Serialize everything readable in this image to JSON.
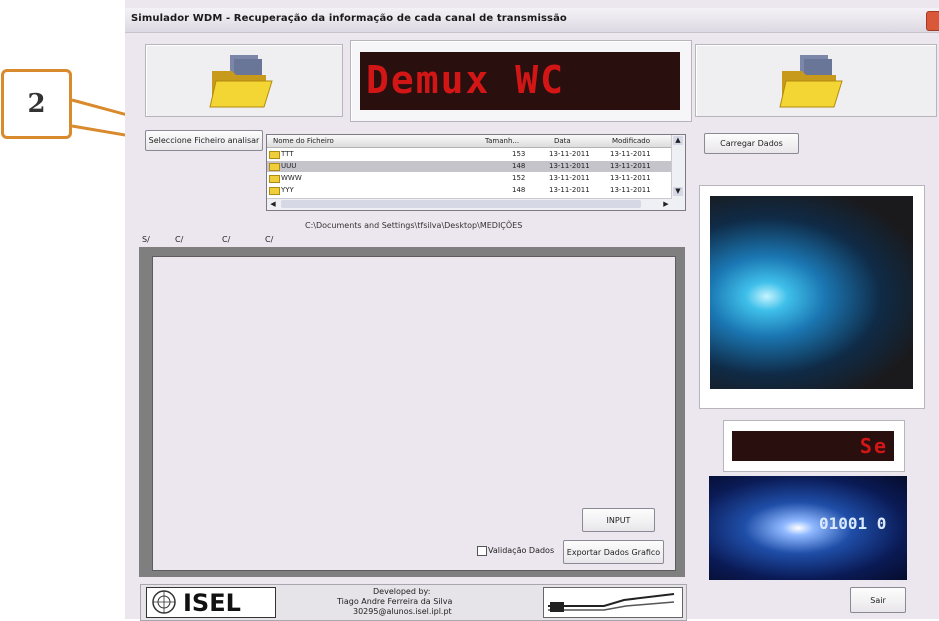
{
  "window": {
    "title": "Simulador WDM - Recuperação da informação de cada canal de transmissão"
  },
  "top_led": {
    "text": "Demux WC"
  },
  "small_led": {
    "text": "Se"
  },
  "buttons": {
    "select_file": "Seleccione Ficheiro analisar",
    "load_data": "Carregar Dados",
    "input": "INPUT",
    "export": "Exportar Dados Grafico",
    "exit": "Sair"
  },
  "file_list": {
    "columns": [
      "Nome do Ficheiro",
      "Tamanh...",
      "Data",
      "Modificado"
    ],
    "rows": [
      {
        "name": "TTT",
        "size": "153",
        "date": "13-11-2011",
        "modified": "13-11-2011",
        "selected": false
      },
      {
        "name": "UUU",
        "size": "148",
        "date": "13-11-2011",
        "modified": "13-11-2011",
        "selected": true
      },
      {
        "name": "WWW",
        "size": "152",
        "date": "13-11-2011",
        "modified": "13-11-2011",
        "selected": false
      },
      {
        "name": "YYY",
        "size": "148",
        "date": "13-11-2011",
        "modified": "13-11-2011",
        "selected": false
      }
    ]
  },
  "path": "C:\\Documents and Settings\\tfsilva\\Desktop\\MEDIÇÕES",
  "tabs": [
    "S/ bck",
    "C/ bck R",
    "C/ bck G",
    "C/ bck B"
  ],
  "checkbox": {
    "label": "Validação Dados",
    "checked": false
  },
  "footer": {
    "logo": "ISEL",
    "developed_by": "Developed by:",
    "author": "Tiago Andre Ferreira da Silva",
    "email": "30295@alunos.isel.ipl.pt"
  },
  "annotation": {
    "number": "2",
    "color": "#d88a2d"
  },
  "colors": {
    "led_red": "#d21616",
    "led_bg": "#2a0f0f",
    "annotation": "#d88a2d"
  }
}
